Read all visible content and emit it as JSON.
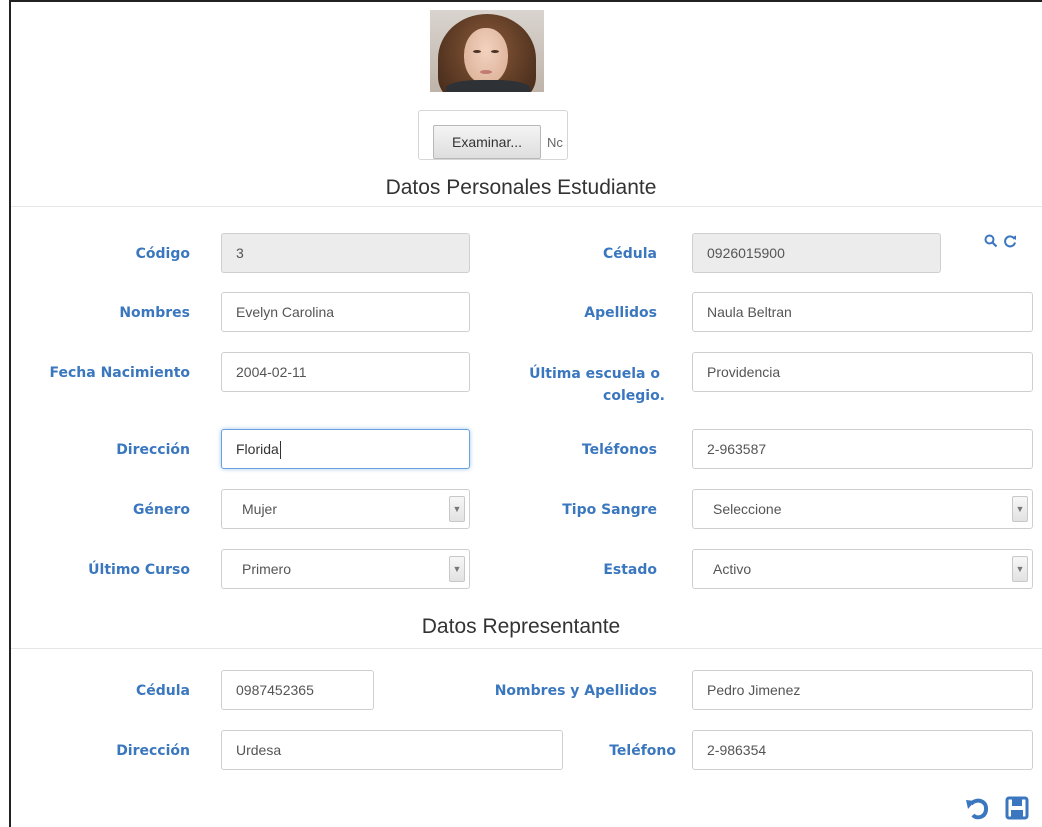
{
  "photo_upload": {
    "button_label": "Examinar...",
    "file_text": "Nc"
  },
  "student_section": {
    "title": "Datos Personales Estudiante",
    "codigo": {
      "label": "Código",
      "value": "3"
    },
    "cedula": {
      "label": "Cédula",
      "value": "0926015900"
    },
    "nombres": {
      "label": "Nombres",
      "value": "Evelyn Carolina"
    },
    "apellidos": {
      "label": "Apellidos",
      "value": "Naula Beltran"
    },
    "fecha_nacimiento": {
      "label": "Fecha Nacimiento",
      "value": "2004-02-11"
    },
    "ultima_escuela": {
      "label_line1": "Última escuela o",
      "label_line2": "colegio.",
      "value": "Providencia"
    },
    "direccion": {
      "label": "Dirección",
      "value": "Florida"
    },
    "telefonos": {
      "label": "Teléfonos",
      "value": "2-963587"
    },
    "genero": {
      "label": "Género",
      "selected": "Mujer"
    },
    "tipo_sangre": {
      "label": "Tipo Sangre",
      "selected": "Seleccione"
    },
    "ultimo_curso": {
      "label": "Último Curso",
      "selected": "Primero"
    },
    "estado": {
      "label": "Estado",
      "selected": "Activo"
    }
  },
  "representative_section": {
    "title": "Datos Representante",
    "cedula": {
      "label": "Cédula",
      "value": "0987452365"
    },
    "nombres_apellidos": {
      "label": "Nombres y Apellidos",
      "value": "Pedro Jimenez"
    },
    "direccion": {
      "label": "Dirección",
      "value": "Urdesa"
    },
    "telefono": {
      "label": "Teléfono",
      "value": "2-986354"
    }
  },
  "icons": {
    "search": "search-icon",
    "refresh": "refresh-icon",
    "undo": "undo-icon",
    "save": "save-icon"
  },
  "colors": {
    "label": "#3a77bf",
    "focus_border": "#66a3e0",
    "readonly_bg": "#ececec"
  }
}
